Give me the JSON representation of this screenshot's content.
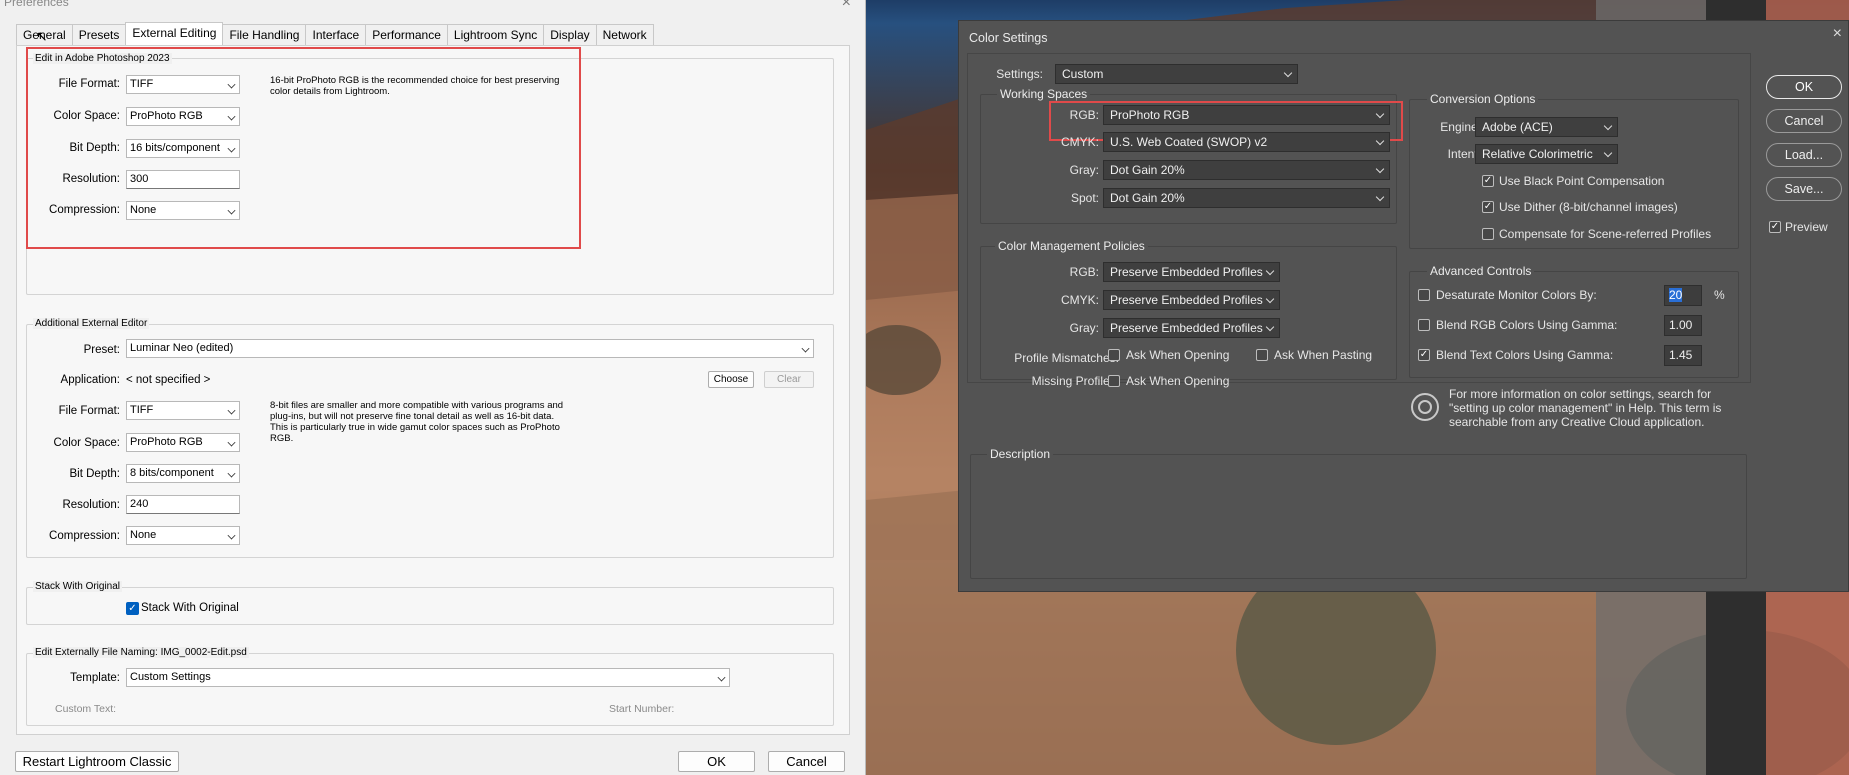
{
  "lr": {
    "title": "Preferences",
    "tabs": [
      "General",
      "Presets",
      "External Editing",
      "File Handling",
      "Interface",
      "Performance",
      "Lightroom Sync",
      "Display",
      "Network"
    ],
    "active_tab": "External Editing",
    "edit_ps": {
      "title": "Edit in Adobe Photoshop 2023",
      "file_format_label": "File Format:",
      "file_format": "TIFF",
      "color_space_label": "Color Space:",
      "color_space": "ProPhoto RGB",
      "bit_depth_label": "Bit Depth:",
      "bit_depth": "16 bits/component",
      "resolution_label": "Resolution:",
      "resolution": "300",
      "compression_label": "Compression:",
      "compression": "None",
      "note": "16-bit ProPhoto RGB is the recommended choice for best preserving color details from Lightroom."
    },
    "additional": {
      "title": "Additional External Editor",
      "preset_label": "Preset:",
      "preset": "Luminar Neo (edited)",
      "application_label": "Application:",
      "application": "< not specified >",
      "choose": "Choose",
      "clear": "Clear",
      "file_format_label": "File Format:",
      "file_format": "TIFF",
      "color_space_label": "Color Space:",
      "color_space": "ProPhoto RGB",
      "bit_depth_label": "Bit Depth:",
      "bit_depth": "8 bits/component",
      "resolution_label": "Resolution:",
      "resolution": "240",
      "compression_label": "Compression:",
      "compression": "None",
      "note": "8-bit files are smaller and more compatible with various programs and plug-ins, but will not preserve fine tonal detail as well as 16-bit data. This is particularly true in wide gamut color spaces such as ProPhoto RGB."
    },
    "stack": {
      "title": "Stack With Original",
      "checkbox": "Stack With Original"
    },
    "naming": {
      "title": "Edit Externally File Naming:  IMG_0002-Edit.psd",
      "template_label": "Template:",
      "template": "Custom Settings",
      "custom_text": "Custom Text:",
      "start_number": "Start Number:"
    },
    "restart": "Restart Lightroom Classic",
    "ok": "OK",
    "cancel": "Cancel"
  },
  "cs": {
    "title": "Color Settings",
    "settings_label": "Settings:",
    "settings": "Custom",
    "working": {
      "title": "Working Spaces",
      "rgb_label": "RGB:",
      "rgb": "ProPhoto RGB",
      "cmyk_label": "CMYK:",
      "cmyk": "U.S. Web Coated (SWOP) v2",
      "gray_label": "Gray:",
      "gray": "Dot Gain 20%",
      "spot_label": "Spot:",
      "spot": "Dot Gain 20%"
    },
    "policies": {
      "title": "Color Management Policies",
      "rgb_label": "RGB:",
      "rgb": "Preserve Embedded Profiles",
      "cmyk_label": "CMYK:",
      "cmyk": "Preserve Embedded Profiles",
      "gray_label": "Gray:",
      "gray": "Preserve Embedded Profiles",
      "mismatch_label": "Profile Mismatches:",
      "ask_opening": "Ask When Opening",
      "ask_pasting": "Ask When Pasting",
      "missing_label": "Missing Profiles:",
      "missing_ask": "Ask When Opening"
    },
    "conversion": {
      "title": "Conversion Options",
      "engine_label": "Engine:",
      "engine": "Adobe (ACE)",
      "intent_label": "Intent:",
      "intent": "Relative Colorimetric",
      "bpc": "Use Black Point Compensation",
      "dither": "Use Dither (8-bit/channel images)",
      "scene": "Compensate for Scene-referred Profiles"
    },
    "advanced": {
      "title": "Advanced Controls",
      "desat": "Desaturate Monitor Colors By:",
      "desat_value": "20",
      "percent": "%",
      "blend_rgb": "Blend RGB Colors Using Gamma:",
      "blend_rgb_value": "1.00",
      "blend_text": "Blend Text Colors Using Gamma:",
      "blend_text_value": "1.45"
    },
    "info": "For more information on color settings, search for \"setting up color management\" in Help. This term is searchable from any Creative Cloud application.",
    "description_title": "Description",
    "buttons": {
      "ok": "OK",
      "cancel": "Cancel",
      "load": "Load...",
      "save": "Save..."
    },
    "preview": "Preview"
  }
}
